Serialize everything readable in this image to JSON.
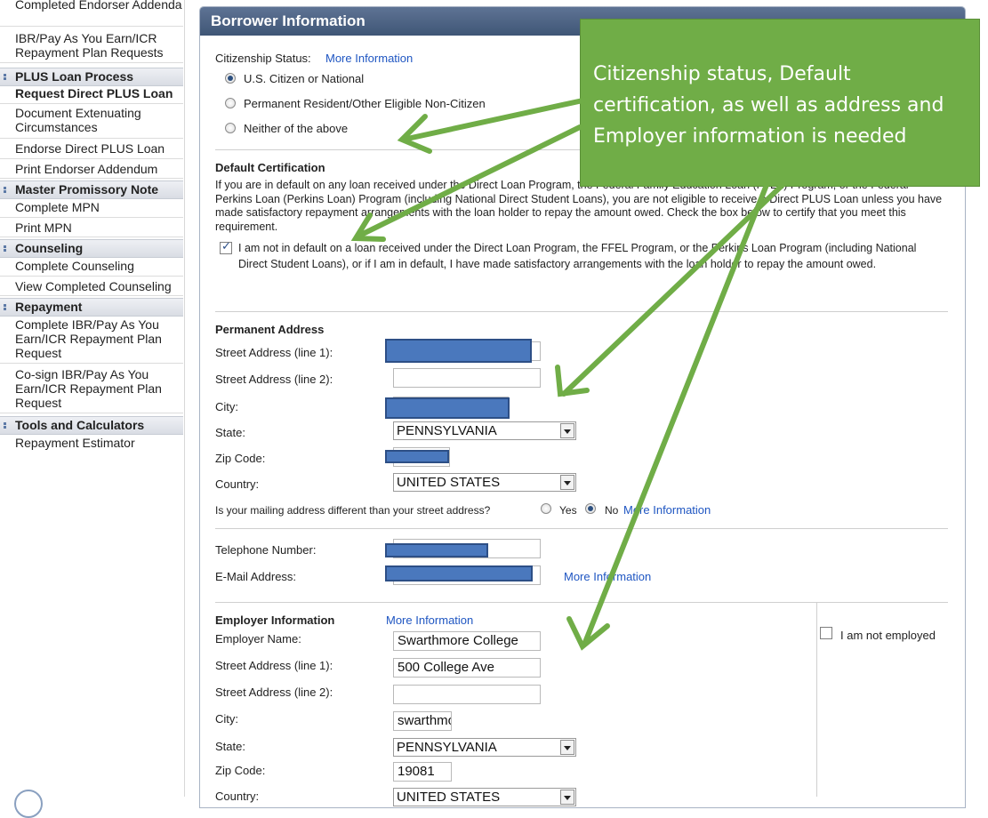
{
  "sidebar": {
    "top_items": [
      "Completed Endorser Addenda",
      "IBR/Pay As You Earn/ICR Repayment Plan Requests"
    ],
    "sections": [
      {
        "header": "PLUS Loan Process",
        "items": [
          "Request Direct PLUS Loan",
          "Document Extenuating Circumstances",
          "Endorse Direct PLUS Loan",
          "Print Endorser Addendum"
        ]
      },
      {
        "header": "Master Promissory Note",
        "items": [
          "Complete MPN",
          "Print MPN"
        ]
      },
      {
        "header": "Counseling",
        "items": [
          "Complete Counseling",
          "View Completed Counseling"
        ]
      },
      {
        "header": "Repayment",
        "items": [
          "Complete IBR/Pay As You Earn/ICR Repayment Plan Request",
          "Co-sign IBR/Pay As You Earn/ICR Repayment Plan Request"
        ]
      },
      {
        "header": "Tools and Calculators",
        "items": [
          "Repayment Estimator"
        ]
      }
    ]
  },
  "panel": {
    "title": "Borrower Information",
    "citizenship": {
      "label": "Citizenship Status:",
      "more_info": "More Information",
      "options": [
        "U.S. Citizen or National",
        "Permanent Resident/Other Eligible Non-Citizen",
        "Neither of the above"
      ],
      "selected_index": 0
    },
    "default_cert": {
      "heading": "Default Certification",
      "paragraph": "If you are in default on any loan received under the Direct Loan Program, the Federal Family Education Loan (FFEL) Program, or the Federal Perkins Loan (Perkins Loan) Program (including National Direct Student Loans), you are not eligible to receive a Direct PLUS Loan unless you have made satisfactory repayment arrangements with the loan holder to repay the amount owed. Check the box below to certify that you meet this requirement.",
      "checkbox_text": "I am not in default on a loan received under the Direct Loan Program, the FFEL Program, or the Perkins Loan Program (including National Direct Student Loans), or if I am in default, I have made satisfactory arrangements with the loan holder to repay the amount owed.",
      "checked": true
    },
    "permanent_address": {
      "heading": "Permanent Address",
      "street1_label": "Street Address (line 1):",
      "street2_label": "Street Address (line 2):",
      "city_label": "City:",
      "state_label": "State:",
      "state_value": "PENNSYLVANIA",
      "zip_label": "Zip Code:",
      "country_label": "Country:",
      "country_value": "UNITED STATES",
      "mailing_question": "Is your mailing address different than your street address?",
      "yes": "Yes",
      "no": "No",
      "mailing_selected": "No",
      "more_info": "More Information"
    },
    "contact": {
      "phone_label": "Telephone Number:",
      "email_label": "E-Mail Address:",
      "more_info": "More Information"
    },
    "employer": {
      "heading": "Employer Information",
      "more_info": "More Information",
      "name_label": "Employer Name:",
      "name_value": "Swarthmore College",
      "street1_label": "Street Address (line 1):",
      "street1_value": "500 College Ave",
      "street2_label": "Street Address (line 2):",
      "street2_value": "",
      "city_label": "City:",
      "city_value": "swarthmo",
      "state_label": "State:",
      "state_value": "PENNSYLVANIA",
      "zip_label": "Zip Code:",
      "zip_value": "19081",
      "country_label": "Country:",
      "country_value": "UNITED STATES",
      "not_employed": "I am not employed"
    }
  },
  "callout": {
    "text": "Citizenship status, Default certification, as well as address and Employer information is needed",
    "color": "#70ad47"
  }
}
